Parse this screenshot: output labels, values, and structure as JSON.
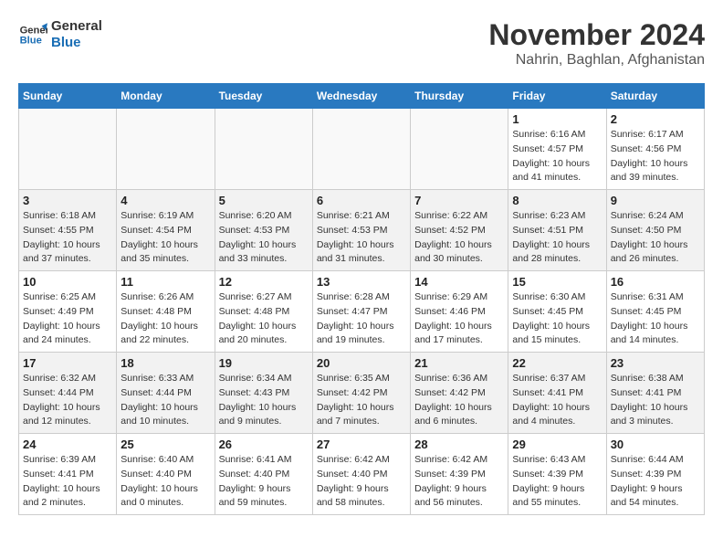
{
  "logo": {
    "line1": "General",
    "line2": "Blue"
  },
  "title": "November 2024",
  "subtitle": "Nahrin, Baghlan, Afghanistan",
  "weekdays": [
    "Sunday",
    "Monday",
    "Tuesday",
    "Wednesday",
    "Thursday",
    "Friday",
    "Saturday"
  ],
  "weeks": [
    [
      {
        "day": "",
        "info": ""
      },
      {
        "day": "",
        "info": ""
      },
      {
        "day": "",
        "info": ""
      },
      {
        "day": "",
        "info": ""
      },
      {
        "day": "",
        "info": ""
      },
      {
        "day": "1",
        "info": "Sunrise: 6:16 AM\nSunset: 4:57 PM\nDaylight: 10 hours\nand 41 minutes."
      },
      {
        "day": "2",
        "info": "Sunrise: 6:17 AM\nSunset: 4:56 PM\nDaylight: 10 hours\nand 39 minutes."
      }
    ],
    [
      {
        "day": "3",
        "info": "Sunrise: 6:18 AM\nSunset: 4:55 PM\nDaylight: 10 hours\nand 37 minutes."
      },
      {
        "day": "4",
        "info": "Sunrise: 6:19 AM\nSunset: 4:54 PM\nDaylight: 10 hours\nand 35 minutes."
      },
      {
        "day": "5",
        "info": "Sunrise: 6:20 AM\nSunset: 4:53 PM\nDaylight: 10 hours\nand 33 minutes."
      },
      {
        "day": "6",
        "info": "Sunrise: 6:21 AM\nSunset: 4:53 PM\nDaylight: 10 hours\nand 31 minutes."
      },
      {
        "day": "7",
        "info": "Sunrise: 6:22 AM\nSunset: 4:52 PM\nDaylight: 10 hours\nand 30 minutes."
      },
      {
        "day": "8",
        "info": "Sunrise: 6:23 AM\nSunset: 4:51 PM\nDaylight: 10 hours\nand 28 minutes."
      },
      {
        "day": "9",
        "info": "Sunrise: 6:24 AM\nSunset: 4:50 PM\nDaylight: 10 hours\nand 26 minutes."
      }
    ],
    [
      {
        "day": "10",
        "info": "Sunrise: 6:25 AM\nSunset: 4:49 PM\nDaylight: 10 hours\nand 24 minutes."
      },
      {
        "day": "11",
        "info": "Sunrise: 6:26 AM\nSunset: 4:48 PM\nDaylight: 10 hours\nand 22 minutes."
      },
      {
        "day": "12",
        "info": "Sunrise: 6:27 AM\nSunset: 4:48 PM\nDaylight: 10 hours\nand 20 minutes."
      },
      {
        "day": "13",
        "info": "Sunrise: 6:28 AM\nSunset: 4:47 PM\nDaylight: 10 hours\nand 19 minutes."
      },
      {
        "day": "14",
        "info": "Sunrise: 6:29 AM\nSunset: 4:46 PM\nDaylight: 10 hours\nand 17 minutes."
      },
      {
        "day": "15",
        "info": "Sunrise: 6:30 AM\nSunset: 4:45 PM\nDaylight: 10 hours\nand 15 minutes."
      },
      {
        "day": "16",
        "info": "Sunrise: 6:31 AM\nSunset: 4:45 PM\nDaylight: 10 hours\nand 14 minutes."
      }
    ],
    [
      {
        "day": "17",
        "info": "Sunrise: 6:32 AM\nSunset: 4:44 PM\nDaylight: 10 hours\nand 12 minutes."
      },
      {
        "day": "18",
        "info": "Sunrise: 6:33 AM\nSunset: 4:44 PM\nDaylight: 10 hours\nand 10 minutes."
      },
      {
        "day": "19",
        "info": "Sunrise: 6:34 AM\nSunset: 4:43 PM\nDaylight: 10 hours\nand 9 minutes."
      },
      {
        "day": "20",
        "info": "Sunrise: 6:35 AM\nSunset: 4:42 PM\nDaylight: 10 hours\nand 7 minutes."
      },
      {
        "day": "21",
        "info": "Sunrise: 6:36 AM\nSunset: 4:42 PM\nDaylight: 10 hours\nand 6 minutes."
      },
      {
        "day": "22",
        "info": "Sunrise: 6:37 AM\nSunset: 4:41 PM\nDaylight: 10 hours\nand 4 minutes."
      },
      {
        "day": "23",
        "info": "Sunrise: 6:38 AM\nSunset: 4:41 PM\nDaylight: 10 hours\nand 3 minutes."
      }
    ],
    [
      {
        "day": "24",
        "info": "Sunrise: 6:39 AM\nSunset: 4:41 PM\nDaylight: 10 hours\nand 2 minutes."
      },
      {
        "day": "25",
        "info": "Sunrise: 6:40 AM\nSunset: 4:40 PM\nDaylight: 10 hours\nand 0 minutes."
      },
      {
        "day": "26",
        "info": "Sunrise: 6:41 AM\nSunset: 4:40 PM\nDaylight: 9 hours\nand 59 minutes."
      },
      {
        "day": "27",
        "info": "Sunrise: 6:42 AM\nSunset: 4:40 PM\nDaylight: 9 hours\nand 58 minutes."
      },
      {
        "day": "28",
        "info": "Sunrise: 6:42 AM\nSunset: 4:39 PM\nDaylight: 9 hours\nand 56 minutes."
      },
      {
        "day": "29",
        "info": "Sunrise: 6:43 AM\nSunset: 4:39 PM\nDaylight: 9 hours\nand 55 minutes."
      },
      {
        "day": "30",
        "info": "Sunrise: 6:44 AM\nSunset: 4:39 PM\nDaylight: 9 hours\nand 54 minutes."
      }
    ]
  ]
}
